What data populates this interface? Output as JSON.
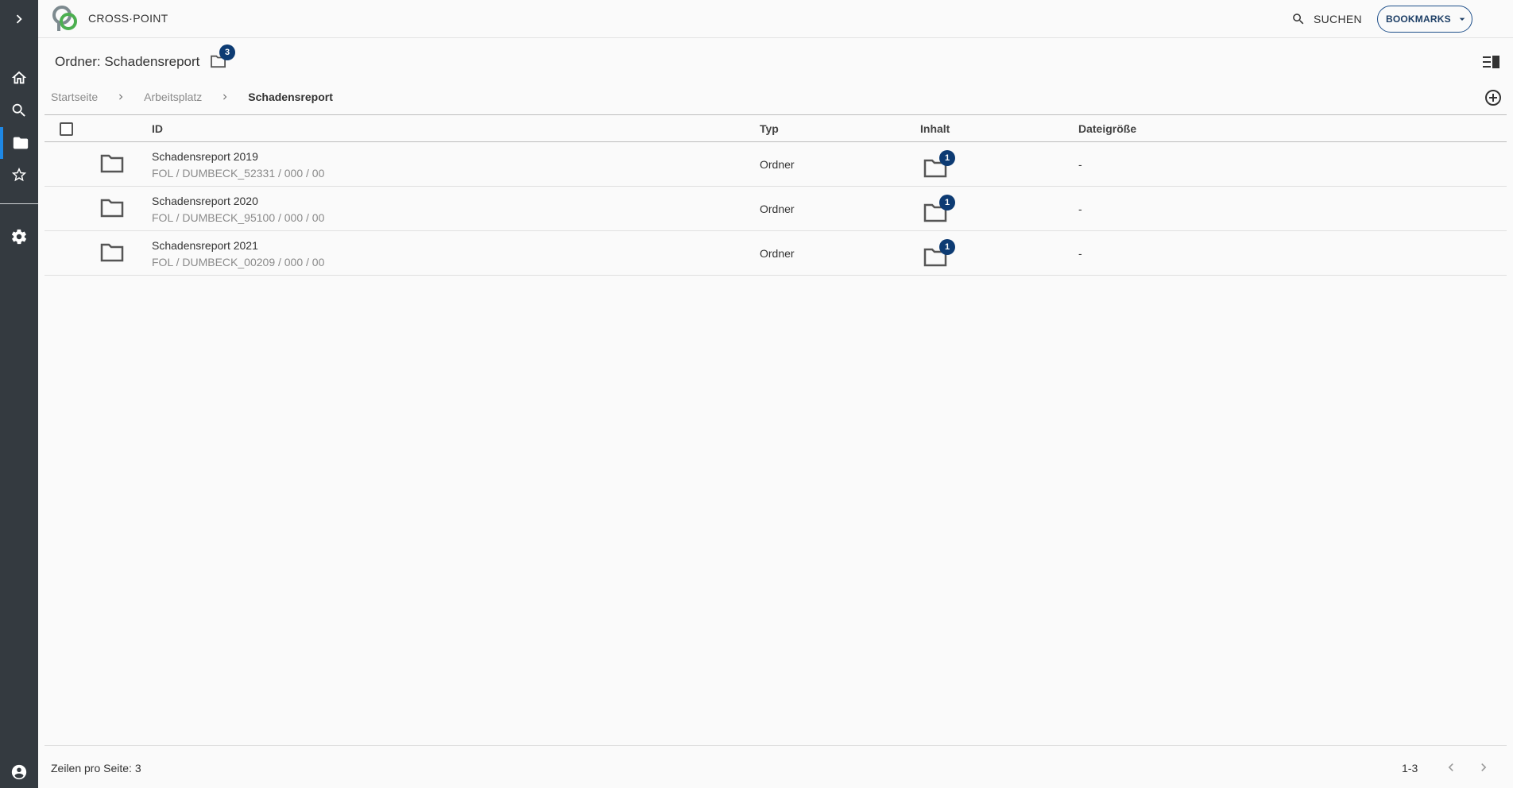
{
  "app": {
    "name": "CROSS·POINT"
  },
  "header": {
    "search_label": "SUCHEN",
    "bookmarks_label": "BOOKMARKS"
  },
  "page": {
    "title": "Ordner: Schadensreport",
    "title_badge": "3"
  },
  "breadcrumb": {
    "items": [
      "Startseite",
      "Arbeitsplatz"
    ],
    "current": "Schadensreport"
  },
  "table": {
    "columns": {
      "id": "ID",
      "typ": "Typ",
      "inhalt": "Inhalt",
      "size": "Dateigröße"
    },
    "rows": [
      {
        "name": "Schadensreport 2019",
        "sub": "FOL / DUMBECK_52331 / 000 / 00",
        "typ": "Ordner",
        "count": "1",
        "size": "-"
      },
      {
        "name": "Schadensreport 2020",
        "sub": "FOL / DUMBECK_95100 / 000 / 00",
        "typ": "Ordner",
        "count": "1",
        "size": "-"
      },
      {
        "name": "Schadensreport 2021",
        "sub": "FOL / DUMBECK_00209 / 000 / 00",
        "typ": "Ordner",
        "count": "1",
        "size": "-"
      }
    ]
  },
  "footer": {
    "rows_per_page": "Zeilen pro Seite: 3",
    "range": "1-3"
  },
  "colors": {
    "rail": "#343a40",
    "accent": "#1e88e5",
    "badge": "#0d3b73"
  },
  "icons": {
    "rail": [
      "chevron-right-icon",
      "home-icon",
      "search-icon",
      "folder-icon",
      "star-icon",
      "gear-icon",
      "account-icon"
    ]
  }
}
